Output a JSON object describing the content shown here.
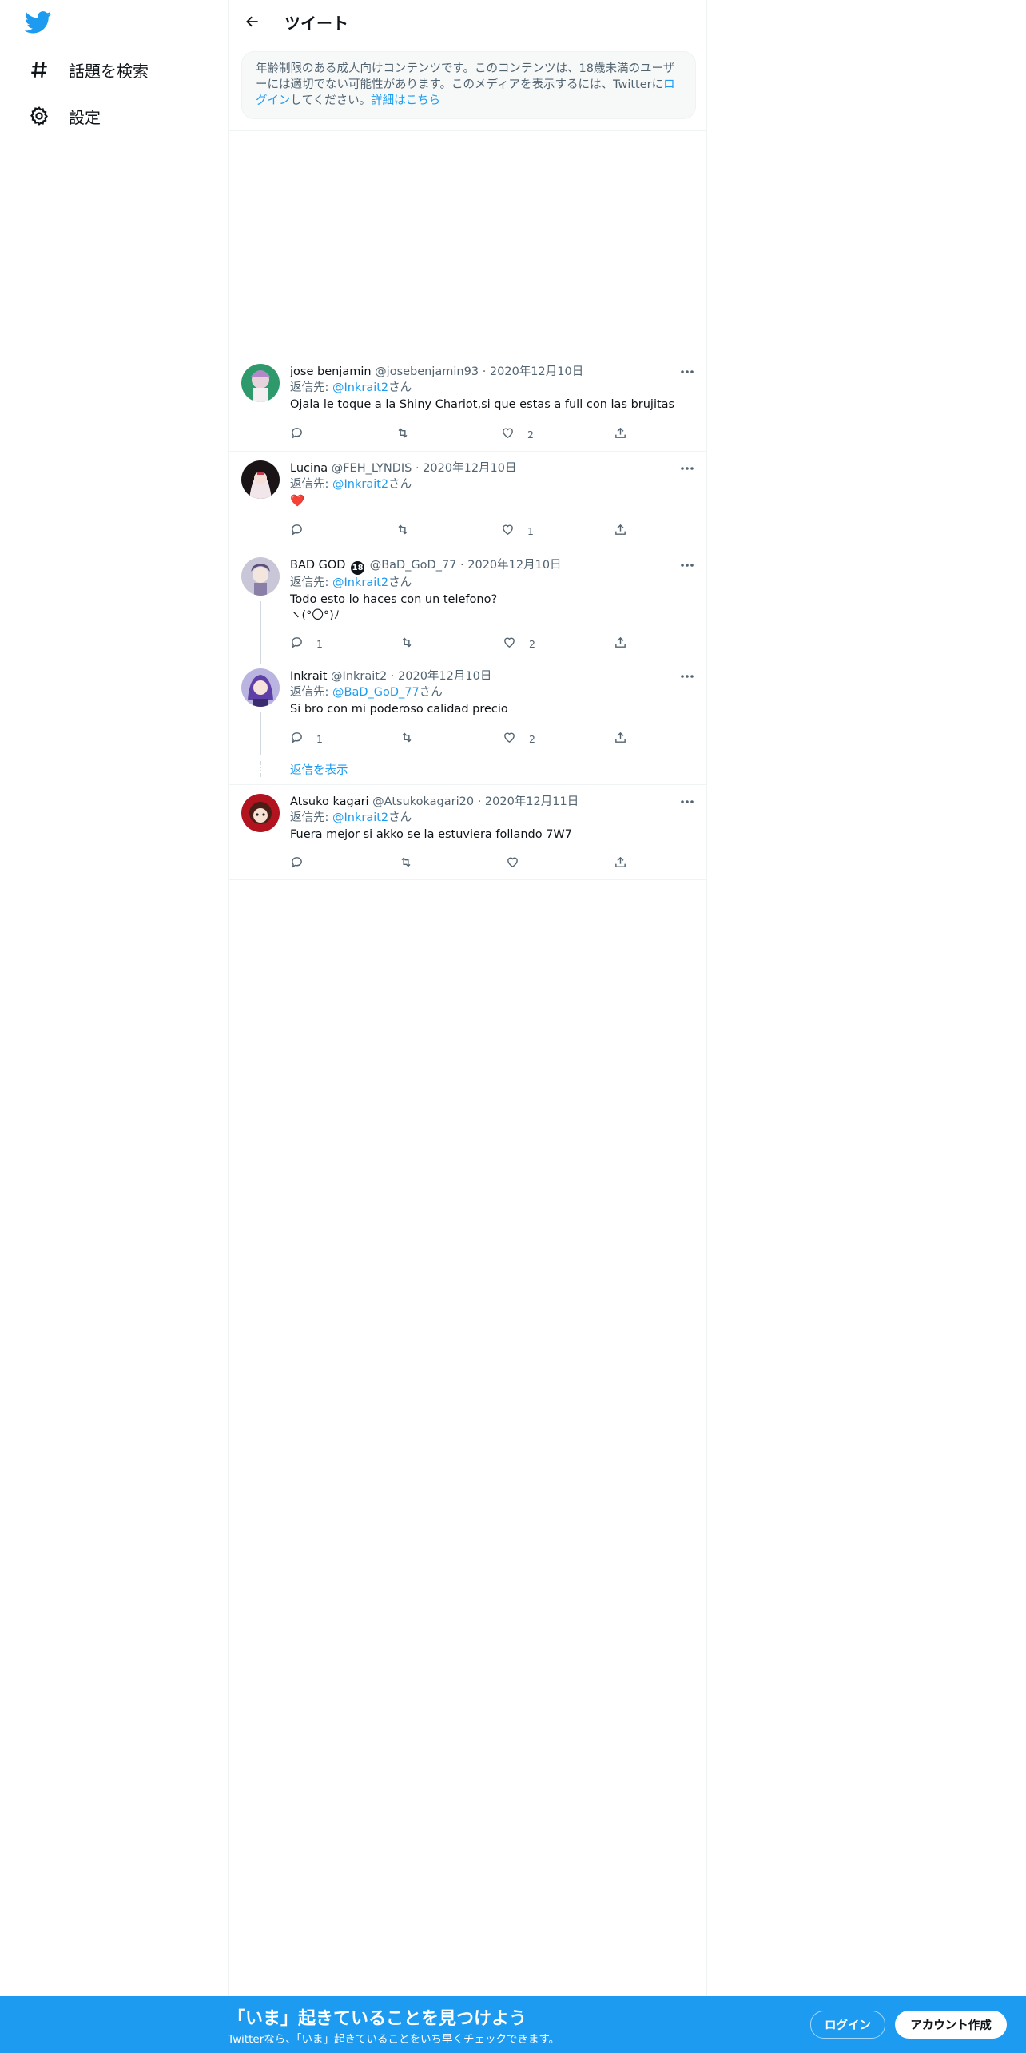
{
  "sidebar": {
    "items": [
      {
        "label": "話題を検索",
        "icon": "hashtag-icon"
      },
      {
        "label": "設定",
        "icon": "gear-icon"
      }
    ]
  },
  "header": {
    "title": "ツイート"
  },
  "notice": {
    "text_before": "年齢制限のある成人向けコンテンツです。このコンテンツは、18歳未満のユーザーには適切でない可能性があります。このメディアを表示するには、Twitter",
    "text_middle": "に",
    "login_link": "ログイン",
    "text_after": "してください。",
    "details_link": "詳細はこちら"
  },
  "tweets": [
    {
      "name": "jose benjamin",
      "handle": "@josebenjamin93",
      "date": "2020年12月10日",
      "reply_label": "返信先: ",
      "reply_to": "@Inkrait2",
      "reply_suffix": "さん",
      "text": "Ojala le toque a la Shiny Chariot,si que estas a full con las brujitas",
      "replies": "",
      "retweets": "",
      "likes": "2"
    },
    {
      "name": "Lucina",
      "handle": "@FEH_LYNDIS",
      "date": "2020年12月10日",
      "reply_label": "返信先: ",
      "reply_to": "@Inkrait2",
      "reply_suffix": "さん",
      "text": "❤️",
      "replies": "",
      "retweets": "",
      "likes": "1"
    },
    {
      "name": "BAD GOD",
      "badge": "18",
      "handle": "@BaD_GoD_77",
      "date": "2020年12月10日",
      "reply_label": "返信先: ",
      "reply_to": "@Inkrait2",
      "reply_suffix": "さん",
      "text": "Todo esto lo haces con un telefono?\nヽ(°〇°)ﾉ",
      "replies": "1",
      "retweets": "",
      "likes": "2"
    },
    {
      "name": "Inkrait",
      "handle": "@Inkrait2",
      "date": "2020年12月10日",
      "reply_label": "返信先: ",
      "reply_to": "@BaD_GoD_77",
      "reply_suffix": "さん",
      "text": "Si bro con mi poderoso calidad precio",
      "replies": "1",
      "retweets": "",
      "likes": "2"
    },
    {
      "name": "Atsuko kagari",
      "handle": "@Atsukokagari20",
      "date": "2020年12月11日",
      "reply_label": "返信先: ",
      "reply_to": "@Inkrait2",
      "reply_suffix": "さん",
      "text": "Fuera mejor si akko se la estuviera follando 7W7",
      "replies": "",
      "retweets": "",
      "likes": ""
    }
  ],
  "show_replies": "返信を表示",
  "bottom_bar": {
    "title": "「いま」起きていることを見つけよう",
    "subtitle": "Twitterなら、「いま」起きていることをいち早くチェックできます。",
    "login": "ログイン",
    "signup": "アカウント作成"
  },
  "colors": {
    "accent": "#1d9bf0",
    "text": "#0f1419",
    "secondary": "#536471",
    "border": "#eff3f4"
  }
}
